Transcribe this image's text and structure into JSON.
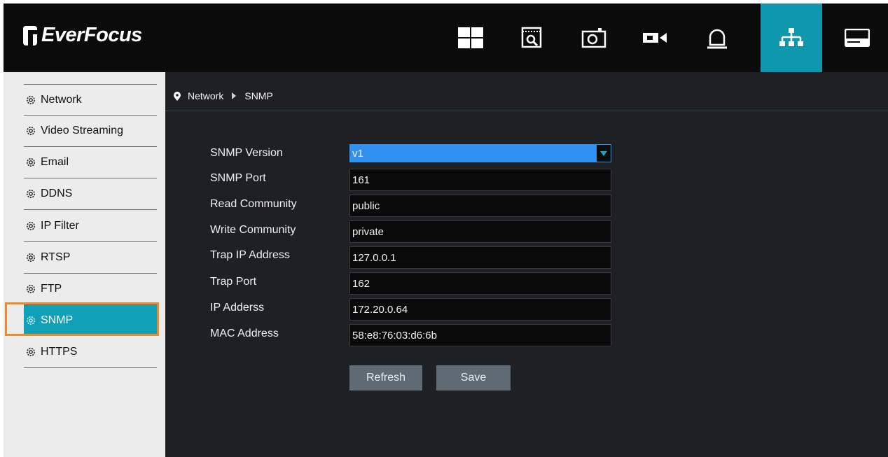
{
  "brand": {
    "name": "EverFocus"
  },
  "toolbar": {
    "icons": [
      {
        "name": "live-view-grid-icon"
      },
      {
        "name": "playback-search-icon"
      },
      {
        "name": "snapshot-icon"
      },
      {
        "name": "camera-icon"
      },
      {
        "name": "alarm-icon"
      },
      {
        "name": "network-icon",
        "active": true
      },
      {
        "name": "storage-icon"
      }
    ]
  },
  "sidebar": {
    "items": [
      {
        "label": "Network"
      },
      {
        "label": "Video Streaming"
      },
      {
        "label": "Email"
      },
      {
        "label": "DDNS"
      },
      {
        "label": "IP Filter"
      },
      {
        "label": "RTSP"
      },
      {
        "label": "FTP"
      },
      {
        "label": "SNMP",
        "active": true
      },
      {
        "label": "HTTPS"
      }
    ]
  },
  "breadcrumb": {
    "section": "Network",
    "page": "SNMP"
  },
  "form": {
    "snmp_version": {
      "label": "SNMP Version",
      "value": "v1"
    },
    "snmp_port": {
      "label": "SNMP Port",
      "value": "161"
    },
    "read_community": {
      "label": "Read Community",
      "value": "public"
    },
    "write_community": {
      "label": "Write Community",
      "value": "private"
    },
    "trap_ip": {
      "label": "Trap IP Address",
      "value": "127.0.0.1"
    },
    "trap_port": {
      "label": "Trap Port",
      "value": "162"
    },
    "ip_address": {
      "label": "IP Adderss",
      "value": "172.20.0.64"
    },
    "mac_address": {
      "label": "MAC Address",
      "value": "58:e8:76:03:d6:6b"
    }
  },
  "buttons": {
    "refresh": "Refresh",
    "save": "Save"
  },
  "colors": {
    "accent": "#0e97ad",
    "highlight": "#ee8a2a",
    "select": "#3191f0"
  }
}
